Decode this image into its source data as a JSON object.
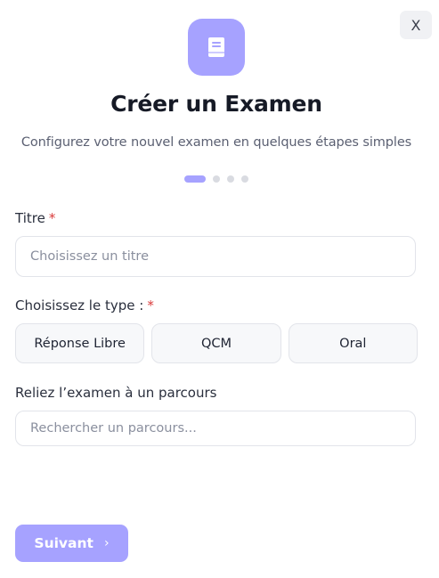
{
  "close_label": "X",
  "logo_icon": "book-icon",
  "title": "Créer un Examen",
  "subtitle": "Configurez votre nouvel examen en quelques étapes simples",
  "steps": {
    "total": 4,
    "current": 1
  },
  "fields": {
    "title_label": "Titre",
    "title_placeholder": "Choisissez un titre",
    "type_label": "Choisissez le type :",
    "required_mark": "*",
    "course_label": "Reliez l’examen à un parcours",
    "course_placeholder": "Rechercher un parcours..."
  },
  "types": [
    "Réponse Libre",
    "QCM",
    "Oral"
  ],
  "next_label": "Suivant",
  "next_icon": "chevron-right-icon",
  "colors": {
    "accent": "#a6a2ff",
    "required": "#d93a3a",
    "step_inactive": "#d9dbe1"
  }
}
